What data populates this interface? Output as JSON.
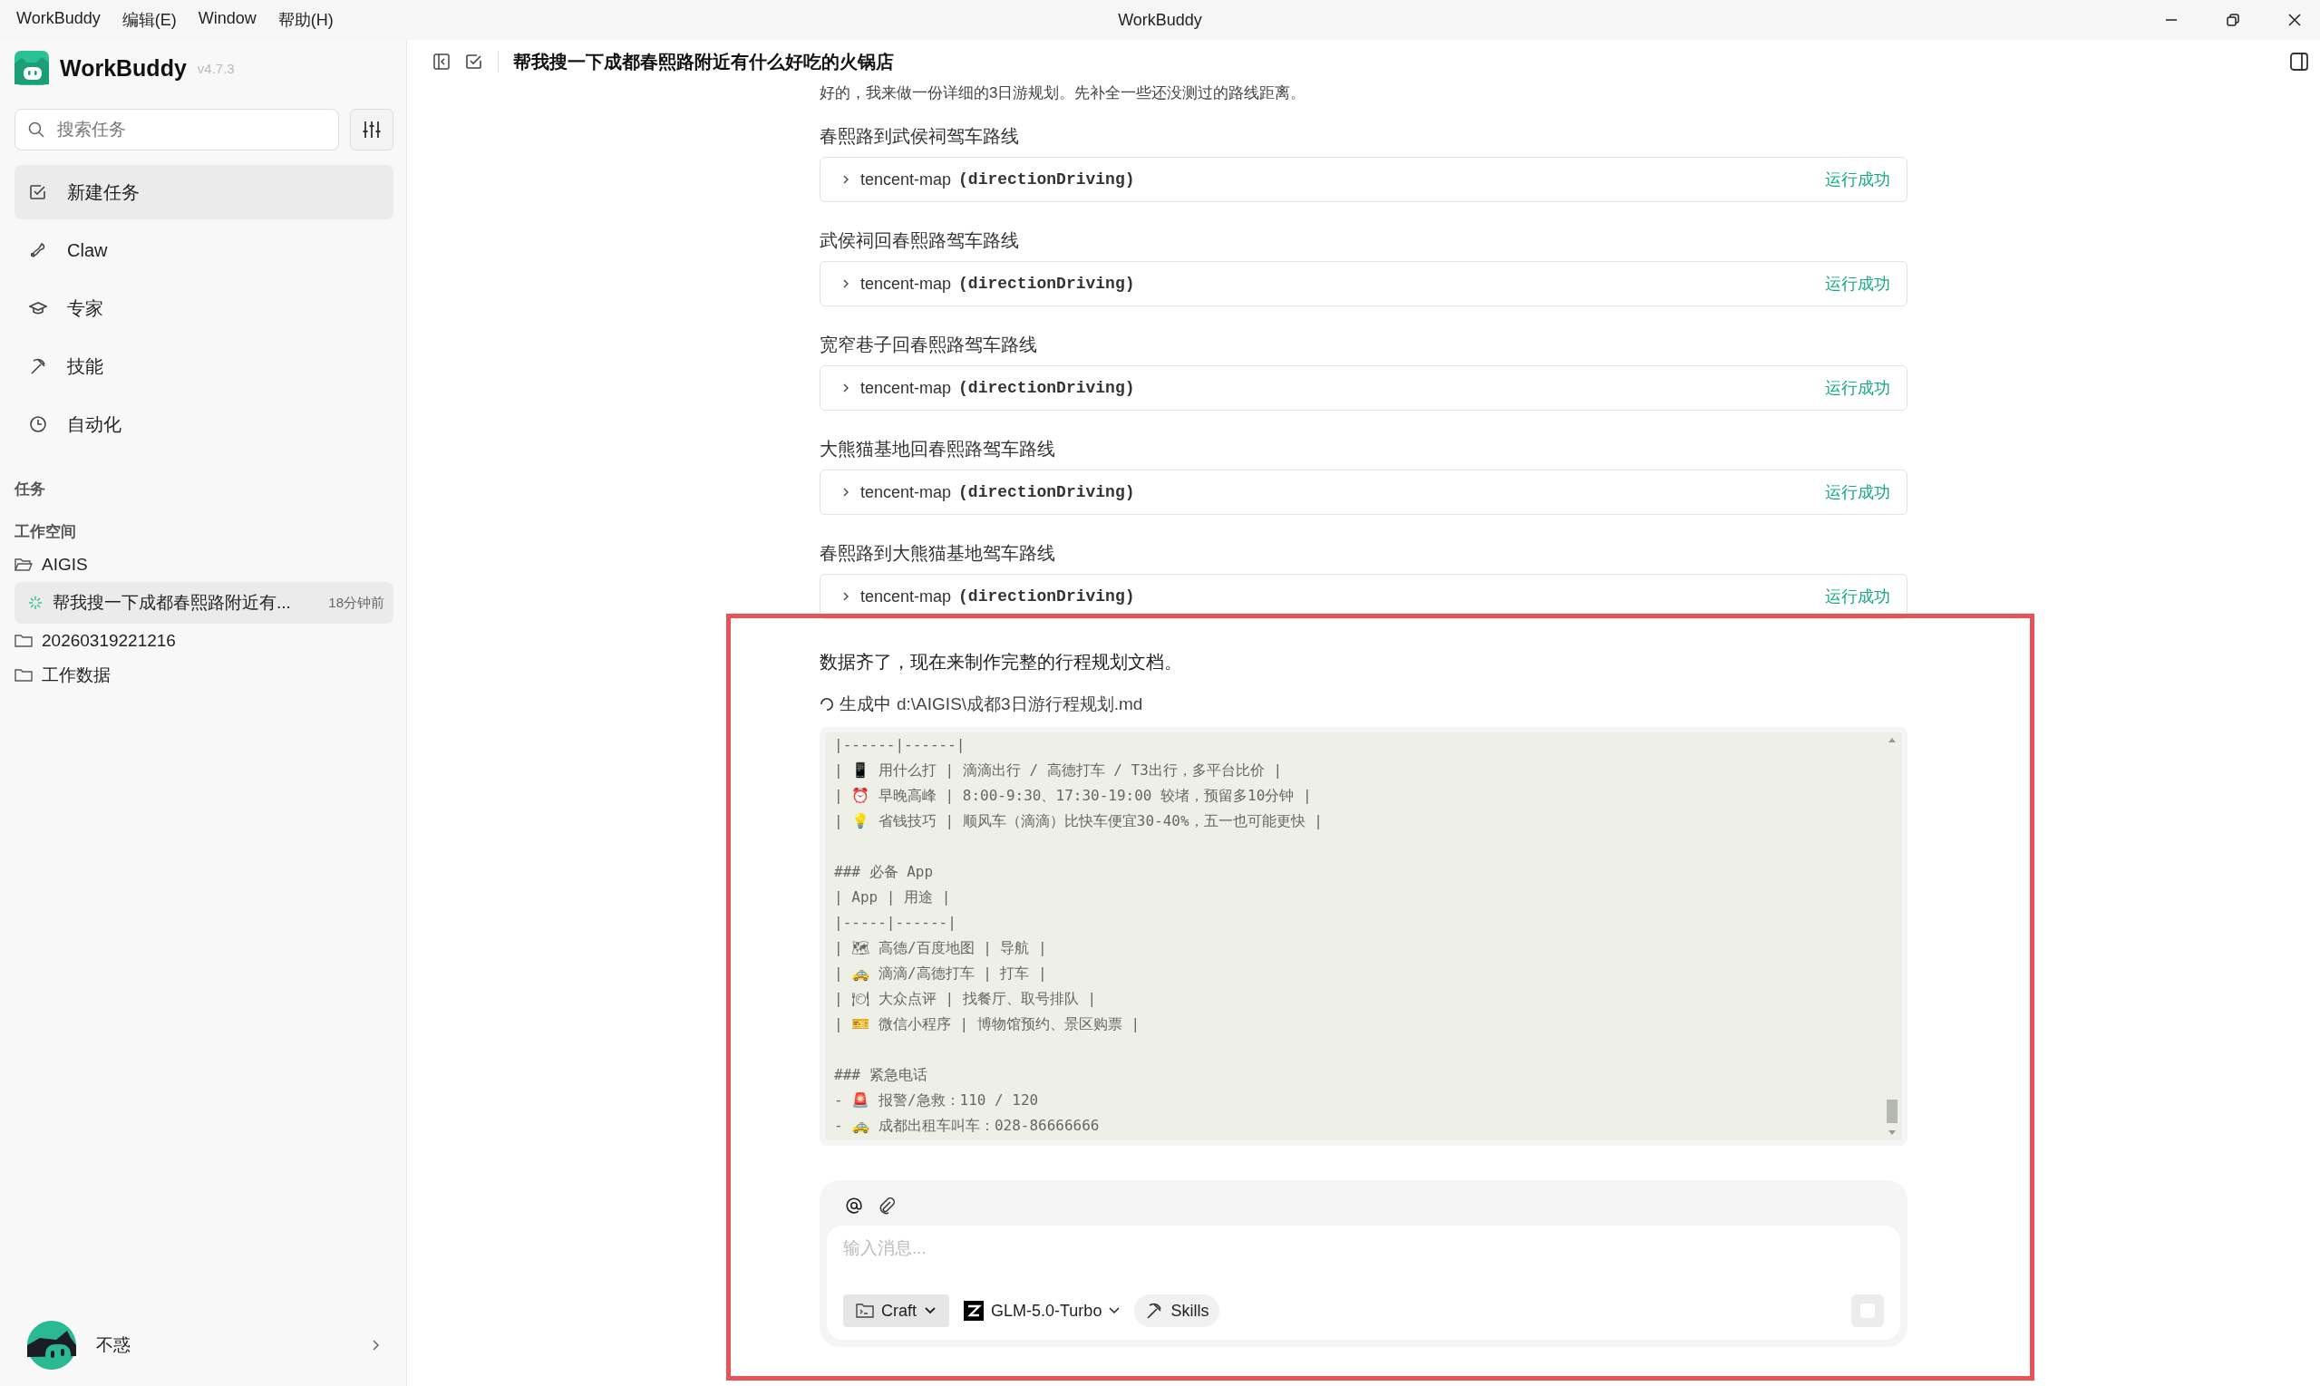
{
  "window": {
    "title": "WorkBuddy",
    "menu": [
      "WorkBuddy",
      "编辑(E)",
      "Window",
      "帮助(H)"
    ]
  },
  "sidebar": {
    "app_name": "WorkBuddy",
    "version": "v4.7.3",
    "search": {
      "placeholder": "搜索任务"
    },
    "nav": [
      {
        "kind": "new",
        "label": "新建任务",
        "selected": true
      },
      {
        "kind": "claw",
        "label": "Claw",
        "selected": false
      },
      {
        "kind": "expert",
        "label": "专家",
        "selected": false
      },
      {
        "kind": "skill",
        "label": "技能",
        "selected": false
      },
      {
        "kind": "auto",
        "label": "自动化",
        "selected": false
      }
    ],
    "tasks_heading": "任务",
    "workspace_heading": "工作空间",
    "folders": [
      {
        "name": "AIGIS",
        "expanded": true,
        "children": [
          {
            "title": "帮我搜一下成都春熙路附近有...",
            "time": "18分钟前",
            "running": true,
            "selected": true
          }
        ]
      },
      {
        "name": "20260319221216",
        "expanded": false
      },
      {
        "name": "工作数据",
        "expanded": false
      }
    ],
    "user": {
      "name": "不惑"
    }
  },
  "chat": {
    "title": "帮我搜一下成都春熙路附近有什么好吃的火锅店",
    "intro": "好的，我来做一份详细的3日游规划。先补全一些还没测过的路线距离。",
    "steps": [
      {
        "heading": "春熙路到武侯祠驾车路线",
        "tool": "tencent-map",
        "method": "(directionDriving)",
        "status": "运行成功"
      },
      {
        "heading": "武侯祠回春熙路驾车路线",
        "tool": "tencent-map",
        "method": "(directionDriving)",
        "status": "运行成功"
      },
      {
        "heading": "宽窄巷子回春熙路驾车路线",
        "tool": "tencent-map",
        "method": "(directionDriving)",
        "status": "运行成功"
      },
      {
        "heading": "大熊猫基地回春熙路驾车路线",
        "tool": "tencent-map",
        "method": "(directionDriving)",
        "status": "运行成功"
      },
      {
        "heading": "春熙路到大熊猫基地驾车路线",
        "tool": "tencent-map",
        "method": "(directionDriving)",
        "status": "运行成功"
      }
    ],
    "message": "数据齐了，现在来制作完整的行程规划文档。",
    "generating": {
      "status": "生成中",
      "path": "d:\\AIGIS\\成都3日游行程规划.md"
    },
    "code_blocks": [
      {
        "lines": [
          "|------|------|",
          "| 📱 用什么打 | 滴滴出行 / 高德打车 / T3出行，多平台比价 |",
          "| ⏰ 早晚高峰 | 8:00-9:30、17:30-19:00 较堵，预留多10分钟 |",
          "| 💡 省钱技巧 | 顺风车（滴滴）比快车便宜30-40%，五一也可能更快 |"
        ]
      },
      {
        "lines": [
          "### 必备 App",
          "| App | 用途 |",
          "|-----|------|",
          "| 🗺 高德/百度地图 | 导航 |",
          "| 🚕 滴滴/高德打车 | 打车 |",
          "| 🍽 大众点评 | 找餐厅、取号排队 |",
          "| 🎫 微信小程序 | 博物馆预约、景区购票 |"
        ]
      },
      {
        "lines": [
          "### 紧急电话",
          "- 🚨 报警/急救：110 / 120",
          "- 🚕 成都出租车叫车：028-86666666"
        ]
      }
    ]
  },
  "composer": {
    "placeholder": "输入消息...",
    "mode": "Craft",
    "model": "GLM-5.0-Turbo",
    "skills": "Skills"
  }
}
